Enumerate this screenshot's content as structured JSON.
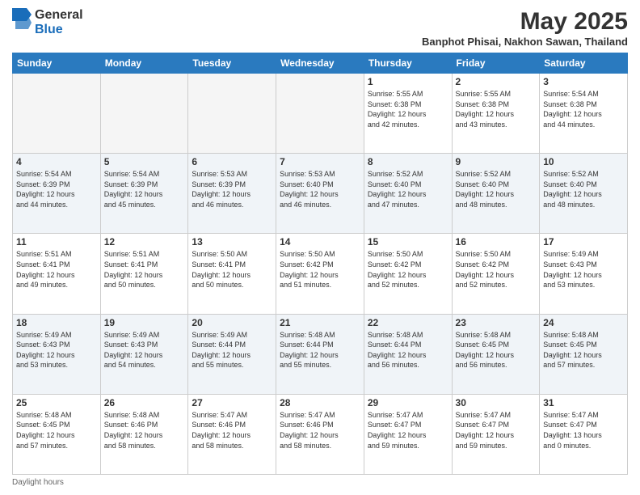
{
  "header": {
    "logo_line1": "General",
    "logo_line2": "Blue",
    "month_title": "May 2025",
    "subtitle": "Banphot Phisai, Nakhon Sawan, Thailand"
  },
  "days_of_week": [
    "Sunday",
    "Monday",
    "Tuesday",
    "Wednesday",
    "Thursday",
    "Friday",
    "Saturday"
  ],
  "weeks": [
    [
      {
        "day": "",
        "info": ""
      },
      {
        "day": "",
        "info": ""
      },
      {
        "day": "",
        "info": ""
      },
      {
        "day": "",
        "info": ""
      },
      {
        "day": "1",
        "info": "Sunrise: 5:55 AM\nSunset: 6:38 PM\nDaylight: 12 hours\nand 42 minutes."
      },
      {
        "day": "2",
        "info": "Sunrise: 5:55 AM\nSunset: 6:38 PM\nDaylight: 12 hours\nand 43 minutes."
      },
      {
        "day": "3",
        "info": "Sunrise: 5:54 AM\nSunset: 6:38 PM\nDaylight: 12 hours\nand 44 minutes."
      }
    ],
    [
      {
        "day": "4",
        "info": "Sunrise: 5:54 AM\nSunset: 6:39 PM\nDaylight: 12 hours\nand 44 minutes."
      },
      {
        "day": "5",
        "info": "Sunrise: 5:54 AM\nSunset: 6:39 PM\nDaylight: 12 hours\nand 45 minutes."
      },
      {
        "day": "6",
        "info": "Sunrise: 5:53 AM\nSunset: 6:39 PM\nDaylight: 12 hours\nand 46 minutes."
      },
      {
        "day": "7",
        "info": "Sunrise: 5:53 AM\nSunset: 6:40 PM\nDaylight: 12 hours\nand 46 minutes."
      },
      {
        "day": "8",
        "info": "Sunrise: 5:52 AM\nSunset: 6:40 PM\nDaylight: 12 hours\nand 47 minutes."
      },
      {
        "day": "9",
        "info": "Sunrise: 5:52 AM\nSunset: 6:40 PM\nDaylight: 12 hours\nand 48 minutes."
      },
      {
        "day": "10",
        "info": "Sunrise: 5:52 AM\nSunset: 6:40 PM\nDaylight: 12 hours\nand 48 minutes."
      }
    ],
    [
      {
        "day": "11",
        "info": "Sunrise: 5:51 AM\nSunset: 6:41 PM\nDaylight: 12 hours\nand 49 minutes."
      },
      {
        "day": "12",
        "info": "Sunrise: 5:51 AM\nSunset: 6:41 PM\nDaylight: 12 hours\nand 50 minutes."
      },
      {
        "day": "13",
        "info": "Sunrise: 5:50 AM\nSunset: 6:41 PM\nDaylight: 12 hours\nand 50 minutes."
      },
      {
        "day": "14",
        "info": "Sunrise: 5:50 AM\nSunset: 6:42 PM\nDaylight: 12 hours\nand 51 minutes."
      },
      {
        "day": "15",
        "info": "Sunrise: 5:50 AM\nSunset: 6:42 PM\nDaylight: 12 hours\nand 52 minutes."
      },
      {
        "day": "16",
        "info": "Sunrise: 5:50 AM\nSunset: 6:42 PM\nDaylight: 12 hours\nand 52 minutes."
      },
      {
        "day": "17",
        "info": "Sunrise: 5:49 AM\nSunset: 6:43 PM\nDaylight: 12 hours\nand 53 minutes."
      }
    ],
    [
      {
        "day": "18",
        "info": "Sunrise: 5:49 AM\nSunset: 6:43 PM\nDaylight: 12 hours\nand 53 minutes."
      },
      {
        "day": "19",
        "info": "Sunrise: 5:49 AM\nSunset: 6:43 PM\nDaylight: 12 hours\nand 54 minutes."
      },
      {
        "day": "20",
        "info": "Sunrise: 5:49 AM\nSunset: 6:44 PM\nDaylight: 12 hours\nand 55 minutes."
      },
      {
        "day": "21",
        "info": "Sunrise: 5:48 AM\nSunset: 6:44 PM\nDaylight: 12 hours\nand 55 minutes."
      },
      {
        "day": "22",
        "info": "Sunrise: 5:48 AM\nSunset: 6:44 PM\nDaylight: 12 hours\nand 56 minutes."
      },
      {
        "day": "23",
        "info": "Sunrise: 5:48 AM\nSunset: 6:45 PM\nDaylight: 12 hours\nand 56 minutes."
      },
      {
        "day": "24",
        "info": "Sunrise: 5:48 AM\nSunset: 6:45 PM\nDaylight: 12 hours\nand 57 minutes."
      }
    ],
    [
      {
        "day": "25",
        "info": "Sunrise: 5:48 AM\nSunset: 6:45 PM\nDaylight: 12 hours\nand 57 minutes."
      },
      {
        "day": "26",
        "info": "Sunrise: 5:48 AM\nSunset: 6:46 PM\nDaylight: 12 hours\nand 58 minutes."
      },
      {
        "day": "27",
        "info": "Sunrise: 5:47 AM\nSunset: 6:46 PM\nDaylight: 12 hours\nand 58 minutes."
      },
      {
        "day": "28",
        "info": "Sunrise: 5:47 AM\nSunset: 6:46 PM\nDaylight: 12 hours\nand 58 minutes."
      },
      {
        "day": "29",
        "info": "Sunrise: 5:47 AM\nSunset: 6:47 PM\nDaylight: 12 hours\nand 59 minutes."
      },
      {
        "day": "30",
        "info": "Sunrise: 5:47 AM\nSunset: 6:47 PM\nDaylight: 12 hours\nand 59 minutes."
      },
      {
        "day": "31",
        "info": "Sunrise: 5:47 AM\nSunset: 6:47 PM\nDaylight: 13 hours\nand 0 minutes."
      }
    ]
  ],
  "footer": {
    "daylight_label": "Daylight hours"
  }
}
